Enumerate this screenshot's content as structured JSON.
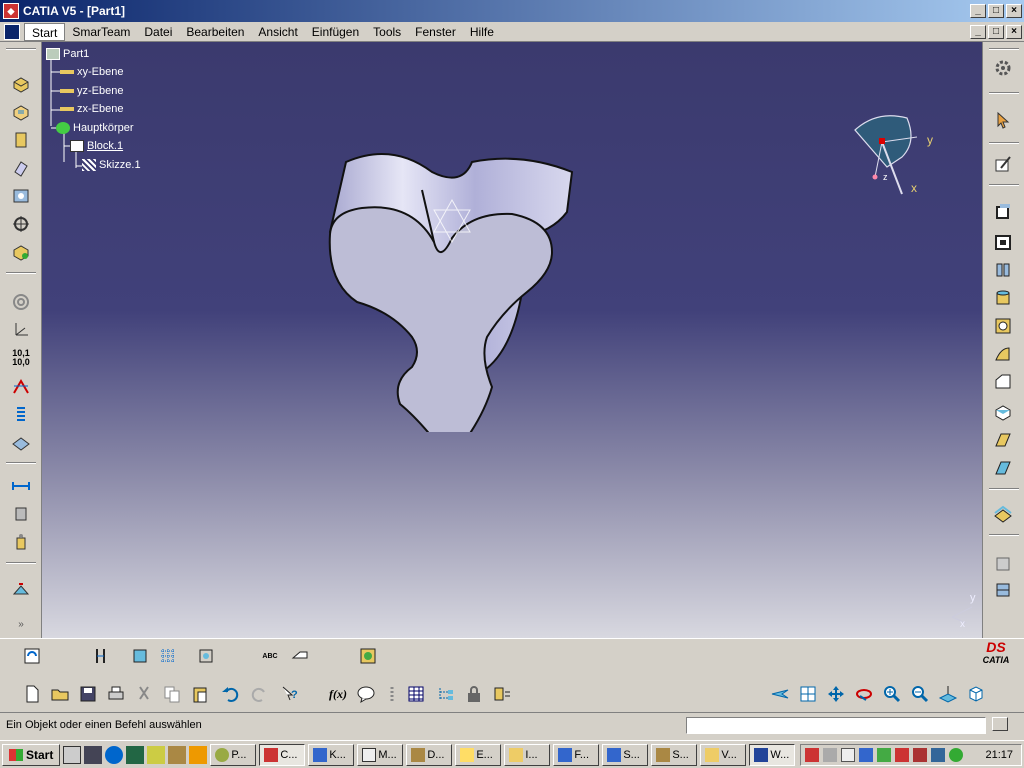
{
  "window": {
    "title": "CATIA V5 - [Part1]",
    "min": "_",
    "max": "□",
    "close": "×"
  },
  "menu": {
    "items": [
      "Start",
      "SmarTeam",
      "Datei",
      "Bearbeiten",
      "Ansicht",
      "Einfügen",
      "Tools",
      "Fenster",
      "Hilfe"
    ]
  },
  "tree": {
    "root": "Part1",
    "planes": [
      "xy-Ebene",
      "yz-Ebene",
      "zx-Ebene"
    ],
    "body": "Hauptkörper",
    "feature": "Block.1",
    "sketch": "Skizze.1"
  },
  "compass": {
    "y": "y",
    "x": "x",
    "z": "z"
  },
  "axis": {
    "y": "y",
    "x": "x"
  },
  "logo": {
    "text": "CATIA",
    "brand": "DS"
  },
  "toolbar": {
    "formula": "f(x)",
    "abc": "ABC"
  },
  "status": {
    "message": "Ein Objekt oder einen Befehl auswählen",
    "cmd_value": ""
  },
  "taskbar": {
    "start": "Start",
    "buttons": [
      "P...",
      "C...",
      "K...",
      "M...",
      "D...",
      "E...",
      "I...",
      "F...",
      "S...",
      "S...",
      "V...",
      "W..."
    ],
    "active_index": 1,
    "clock": "21:17"
  },
  "colors": {
    "title_start": "#0a246a",
    "title_end": "#a6caf0",
    "viewport_top": "#3b3a6e",
    "part": "#c8c8e6"
  }
}
